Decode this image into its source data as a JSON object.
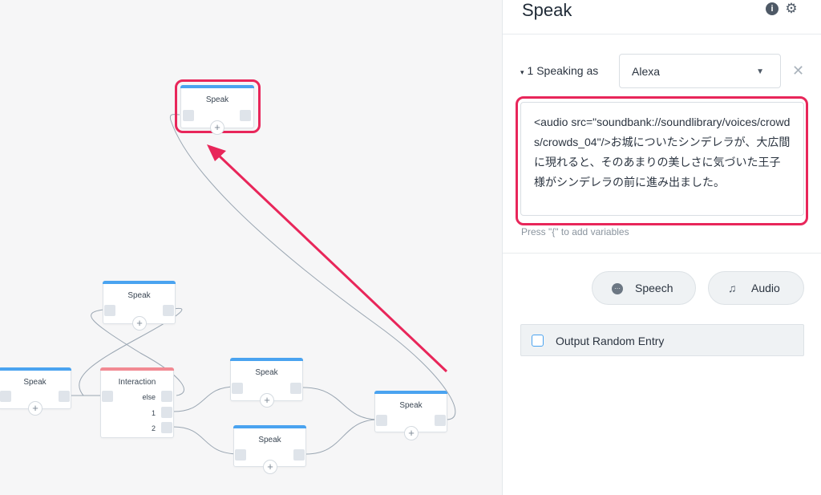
{
  "canvas": {
    "nodes": {
      "speak_top": {
        "title": "Speak",
        "plus": "+"
      },
      "speak_upper": {
        "title": "Speak",
        "plus": "+"
      },
      "speak_left": {
        "title": "Speak",
        "plus": "+"
      },
      "interaction": {
        "title": "Interaction",
        "branches": [
          "else",
          "1",
          "2"
        ]
      },
      "speak_mid": {
        "title": "Speak",
        "plus": "+"
      },
      "speak_low": {
        "title": "Speak",
        "plus": "+"
      },
      "speak_right": {
        "title": "Speak",
        "plus": "+"
      }
    }
  },
  "panel": {
    "title": "Speak",
    "info_icon": "i",
    "speaking_as_caret": "▾",
    "speaking_as_label": "1 Speaking as",
    "voice_value": "Alexa",
    "dropdown_caret": "▼",
    "remove_symbol": "✕",
    "text_content": "<audio src=\"soundbank://soundlibrary/voices/crowds/crowds_04\"/>お城についたシンデレラが、大広間に現れると、そのあまりの美しさに気づいた王子様がシンデレラの前に進み出ました。",
    "hint": "Press \"{\" to add variables",
    "speech_button": "Speech",
    "speech_icon_glyph": "···",
    "audio_button": "Audio",
    "audio_icon_glyph": "♫",
    "output_random": "Output Random Entry"
  },
  "colors": {
    "speak_bar": "#4aa3f0",
    "interaction_bar": "#f28a93",
    "highlight": "#e8265a"
  },
  "icons": [
    "info-icon",
    "gear-icon",
    "chevron-down-icon",
    "close-icon",
    "speech-icon",
    "music-note-icon",
    "plus-icon",
    "checkbox-icon"
  ]
}
